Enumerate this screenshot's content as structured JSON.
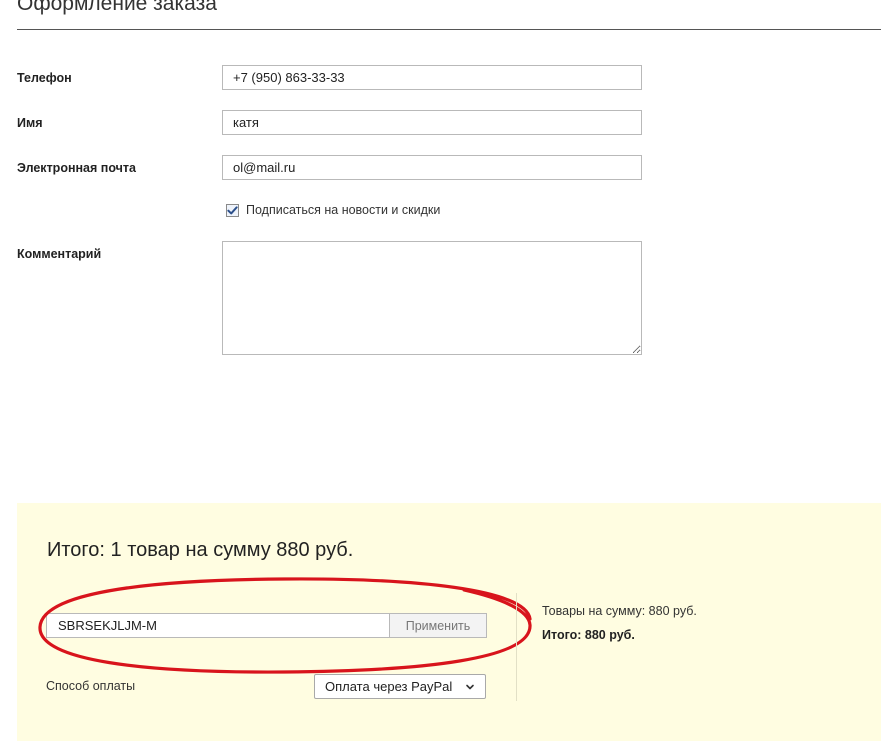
{
  "page": {
    "title": "Оформление заказа"
  },
  "form": {
    "phone": {
      "label": "Телефон",
      "value": "+7 (950) 863-33-33"
    },
    "name": {
      "label": "Имя",
      "value": "катя"
    },
    "email": {
      "label": "Электронная почта",
      "value": "ol@mail.ru"
    },
    "subscribe": {
      "label": "Подписаться на новости и скидки",
      "checked": true
    },
    "comment": {
      "label": "Комментарий",
      "value": ""
    }
  },
  "summary": {
    "heading": "Итого: 1 товар на сумму 880 руб.",
    "coupon": {
      "value": "SBRSEKJLJM-M",
      "apply_label": "Применить"
    },
    "payment": {
      "label": "Способ оплаты",
      "selected": "Оплата через PayPal"
    },
    "goods_sum": "Товары на сумму: 880 руб.",
    "grand_total": "Итого: 880 руб."
  },
  "colors": {
    "summary_background": "#fffde1",
    "annotation_ellipse": "#d8141c",
    "checkbox_check": "#2b4f8a"
  },
  "icons": {
    "checkbox": "checkmark-icon",
    "select": "chevron-down-icon"
  }
}
